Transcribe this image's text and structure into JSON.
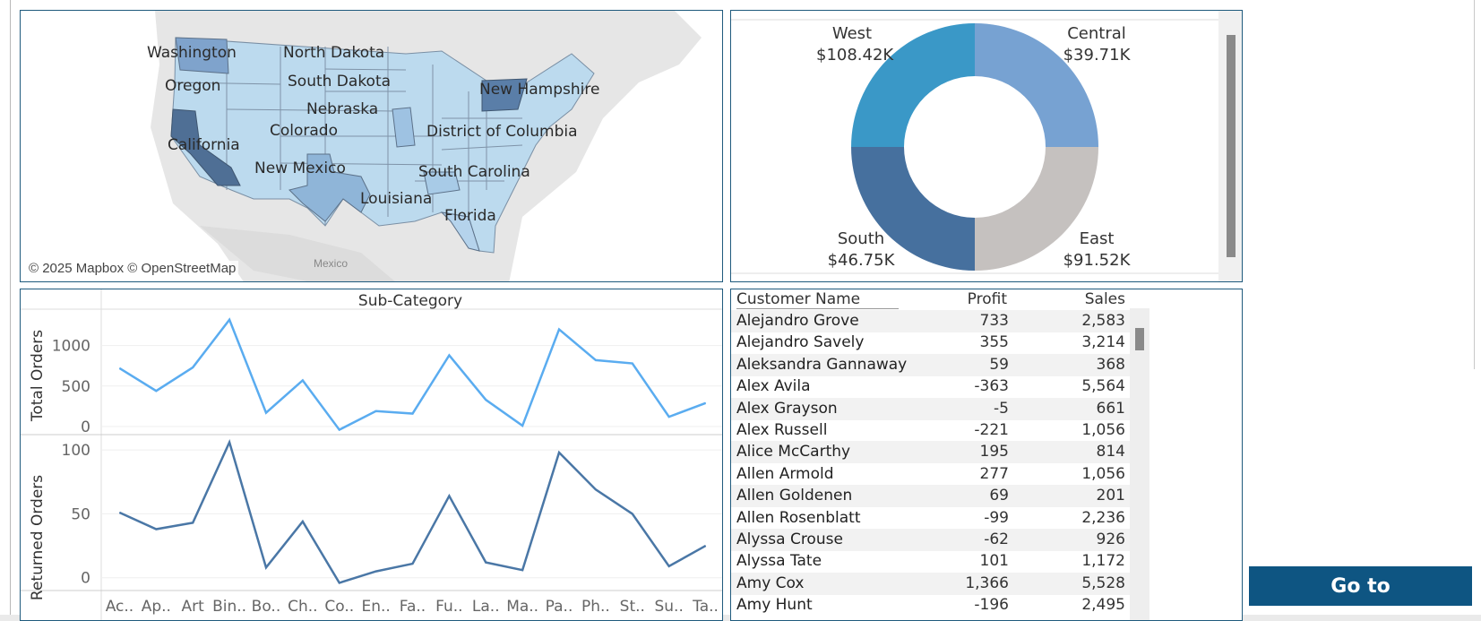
{
  "map": {
    "labels": [
      "Washington",
      "North Dakota",
      "Oregon",
      "South Dakota",
      "New Hampshire",
      "Nebraska",
      "California",
      "Colorado",
      "District of Columbia",
      "New Mexico",
      "South Carolina",
      "Louisiana",
      "Florida"
    ],
    "attribution": "© 2025 Mapbox © OpenStreetMap",
    "mexico_label": "Mexico"
  },
  "donut": {
    "regions": [
      {
        "name": "West",
        "value": "$108.42K",
        "color": "#3a98c7"
      },
      {
        "name": "Central",
        "value": "$39.71K",
        "color": "#77a2d2"
      },
      {
        "name": "South",
        "value": "$46.75K",
        "color": "#46709e"
      },
      {
        "name": "East",
        "value": "$91.52K",
        "color": "#c5c1bf"
      }
    ]
  },
  "chart_data": {
    "type": "line",
    "title": "Sub-Category",
    "categories": [
      "Ac..",
      "Ap..",
      "Art",
      "Bin..",
      "Bo..",
      "Ch..",
      "Co..",
      "En..",
      "Fa..",
      "Fu..",
      "La..",
      "Ma..",
      "Pa..",
      "Ph..",
      "St..",
      "Su..",
      "Ta.."
    ],
    "series": [
      {
        "name": "Total Orders",
        "color": "#5aacf0",
        "values": [
          720,
          440,
          730,
          1320,
          170,
          570,
          -40,
          190,
          160,
          880,
          330,
          10,
          1200,
          820,
          780,
          120,
          290
        ],
        "ylim": [
          -100,
          1450
        ],
        "ticks": [
          0,
          500,
          1000
        ]
      },
      {
        "name": "Returned Orders",
        "color": "#4a77a6",
        "values": [
          51,
          38,
          43,
          106,
          8,
          44,
          -4,
          5,
          11,
          64,
          12,
          6,
          98,
          69,
          50,
          9,
          25
        ],
        "ylim": [
          -10,
          112
        ],
        "ticks": [
          0,
          50,
          100
        ]
      }
    ]
  },
  "table": {
    "headers": {
      "name": "Customer Name",
      "profit": "Profit",
      "sales": "Sales"
    },
    "rows": [
      {
        "name": "Alejandro Grove",
        "profit": "733",
        "sales": "2,583"
      },
      {
        "name": "Alejandro Savely",
        "profit": "355",
        "sales": "3,214"
      },
      {
        "name": "Aleksandra Gannaway",
        "profit": "59",
        "sales": "368"
      },
      {
        "name": "Alex Avila",
        "profit": "-363",
        "sales": "5,564"
      },
      {
        "name": "Alex Grayson",
        "profit": "-5",
        "sales": "661"
      },
      {
        "name": "Alex Russell",
        "profit": "-221",
        "sales": "1,056"
      },
      {
        "name": "Alice McCarthy",
        "profit": "195",
        "sales": "814"
      },
      {
        "name": "Allen Armold",
        "profit": "277",
        "sales": "1,056"
      },
      {
        "name": "Allen Goldenen",
        "profit": "69",
        "sales": "201"
      },
      {
        "name": "Allen Rosenblatt",
        "profit": "-99",
        "sales": "2,236"
      },
      {
        "name": "Alyssa Crouse",
        "profit": "-62",
        "sales": "926"
      },
      {
        "name": "Alyssa Tate",
        "profit": "101",
        "sales": "1,172"
      },
      {
        "name": "Amy Cox",
        "profit": "1,366",
        "sales": "5,528"
      },
      {
        "name": "Amy Hunt",
        "profit": "-196",
        "sales": "2,495"
      }
    ]
  },
  "goto_button": "Go to"
}
